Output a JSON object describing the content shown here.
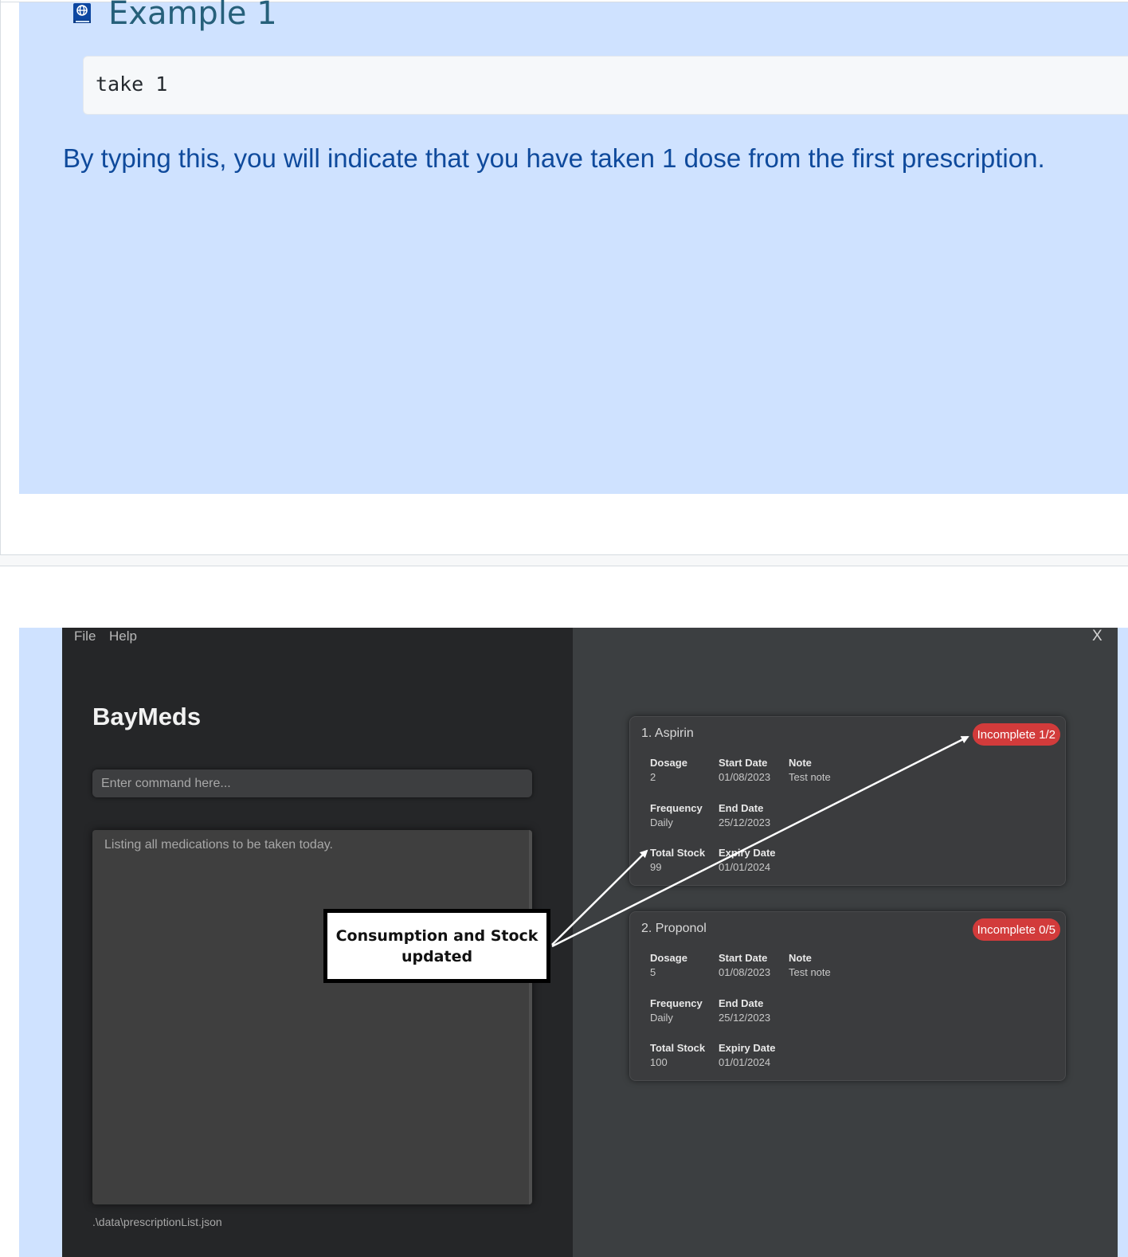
{
  "example": {
    "title": "Example 1",
    "code": "take 1",
    "description": "By typing this, you will indicate that you have taken 1 dose from the first prescription."
  },
  "app": {
    "menu": {
      "file": "File",
      "help": "Help"
    },
    "close_label": "X",
    "title": "BayMeds",
    "command_placeholder": "Enter command here...",
    "result_text": "Listing all medications to be taken today.",
    "file_path": ".\\data\\prescriptionList.json",
    "cards": [
      {
        "title": "1.  Aspirin",
        "badge": "Incomplete 1/2",
        "dosage_label": "Dosage",
        "dosage": "2",
        "start_label": "Start Date",
        "start": "01/08/2023",
        "note_label": "Note",
        "note": "Test note",
        "frequency_label": "Frequency",
        "frequency": "Daily",
        "end_label": "End Date",
        "end": "25/12/2023",
        "stock_label": "Total Stock",
        "stock": "99",
        "expiry_label": "Expiry Date",
        "expiry": "01/01/2024"
      },
      {
        "title": "2.  Proponol",
        "badge": "Incomplete 0/5",
        "dosage_label": "Dosage",
        "dosage": "5",
        "start_label": "Start Date",
        "start": "01/08/2023",
        "note_label": "Note",
        "note": "Test note",
        "frequency_label": "Frequency",
        "frequency": "Daily",
        "end_label": "End Date",
        "end": "25/12/2023",
        "stock_label": "Total Stock",
        "stock": "100",
        "expiry_label": "Expiry Date",
        "expiry": "01/01/2024"
      }
    ]
  },
  "annotation": {
    "text": "Consumption and Stock updated"
  },
  "colors": {
    "panel_bg": "#cfe2ff",
    "badge_red": "#d23b3b",
    "app_dark": "#252628"
  }
}
